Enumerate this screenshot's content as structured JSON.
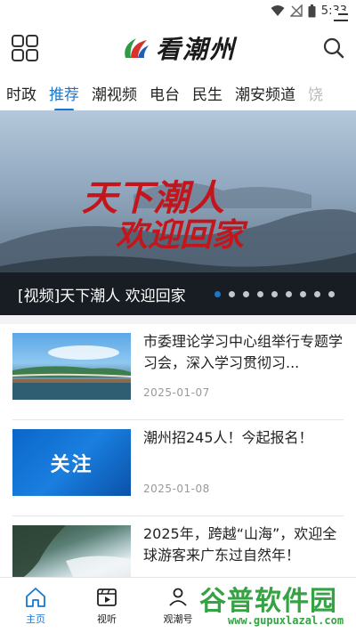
{
  "status_bar": {
    "time": "5:33"
  },
  "header": {
    "logo_text": "看潮州"
  },
  "tabs": [
    {
      "label": "时政"
    },
    {
      "label": "推荐"
    },
    {
      "label": "潮视频"
    },
    {
      "label": "电台"
    },
    {
      "label": "民生"
    },
    {
      "label": "潮安频道"
    },
    {
      "label": "饶"
    }
  ],
  "banner": {
    "art_line1": "天下潮人",
    "art_line2": "欢迎回家",
    "caption": "[视频]天下潮人 欢迎回家",
    "dot_count": 9,
    "active_dot": 0
  },
  "news": [
    {
      "title": "市委理论学习中心组举行专题学习会，深入学习贯彻习...",
      "date": "2025-01-07"
    },
    {
      "title": "潮州招245人！今起报名！",
      "date": "2025-01-08",
      "thumb_text": "关注"
    },
    {
      "title": "2025年，跨越“山海”，欢迎全球游客来广东过自然年！",
      "date": ""
    }
  ],
  "bottom_nav": [
    {
      "label": "主页",
      "icon": "home-icon"
    },
    {
      "label": "视听",
      "icon": "video-icon"
    },
    {
      "label": "观潮号",
      "icon": "profile-icon"
    }
  ],
  "watermark": {
    "title": "谷普软件园",
    "url": "www.gupuxlazal.com"
  },
  "colors": {
    "accent": "#1677d2",
    "watermark": "#35a243"
  }
}
